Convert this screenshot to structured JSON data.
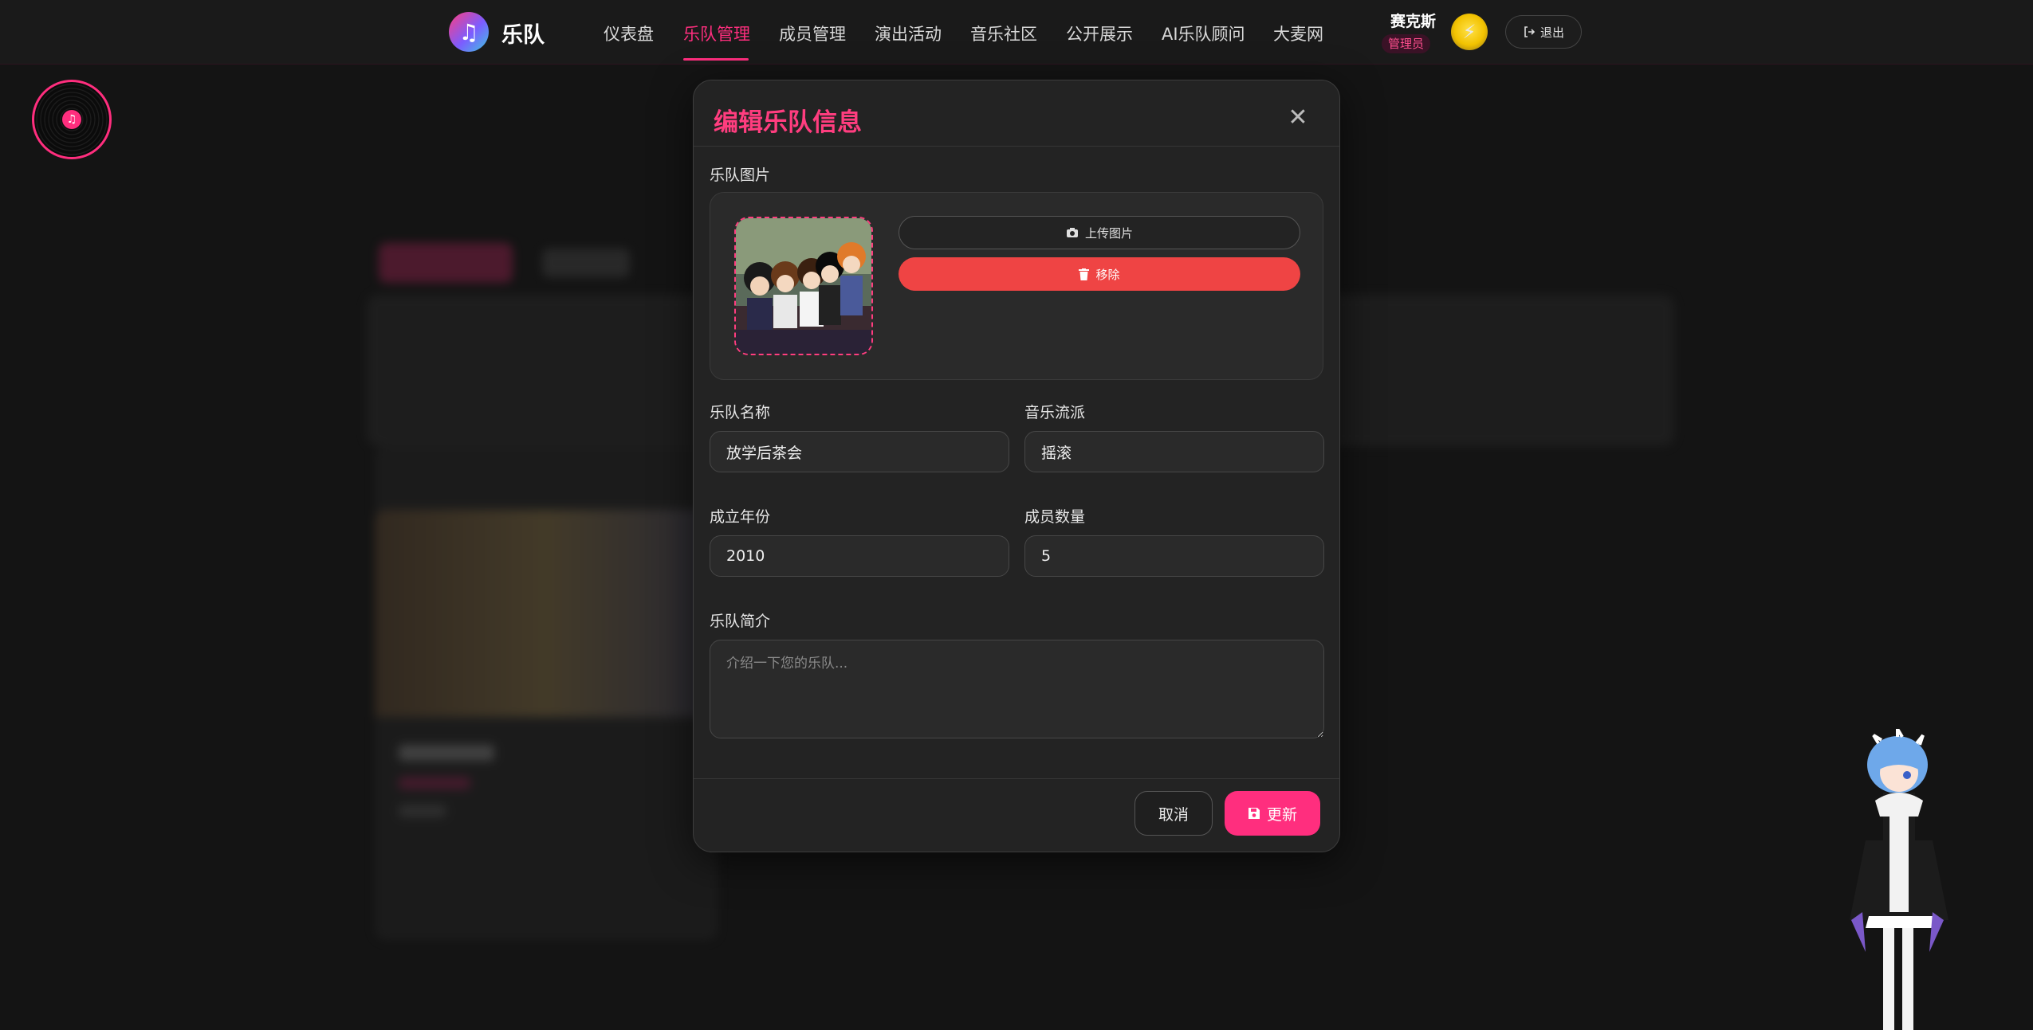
{
  "nav": {
    "logo_text": "乐队",
    "items": [
      {
        "label": "仪表盘",
        "active": false
      },
      {
        "label": "乐队管理",
        "active": true
      },
      {
        "label": "成员管理",
        "active": false
      },
      {
        "label": "演出活动",
        "active": false
      },
      {
        "label": "音乐社区",
        "active": false
      },
      {
        "label": "公开展示",
        "active": false
      },
      {
        "label": "AI乐队顾问",
        "active": false
      },
      {
        "label": "大麦网",
        "active": false
      }
    ],
    "user_name": "赛克斯",
    "user_role": "管理员",
    "logout_label": "退出"
  },
  "modal": {
    "title": "编辑乐队信息",
    "image_section_label": "乐队图片",
    "upload_label": "上传图片",
    "remove_label": "移除",
    "fields": {
      "name_label": "乐队名称",
      "name_value": "放学后茶会",
      "genre_label": "音乐流派",
      "genre_value": "摇滚",
      "year_label": "成立年份",
      "year_value": "2010",
      "members_label": "成员数量",
      "members_value": "5",
      "intro_label": "乐队简介",
      "intro_placeholder": "介绍一下您的乐队..."
    },
    "cancel_label": "取消",
    "update_label": "更新"
  },
  "colors": {
    "accent": "#ff2e7e",
    "danger": "#ef4444",
    "background": "#141414",
    "modal_bg": "#232323"
  }
}
